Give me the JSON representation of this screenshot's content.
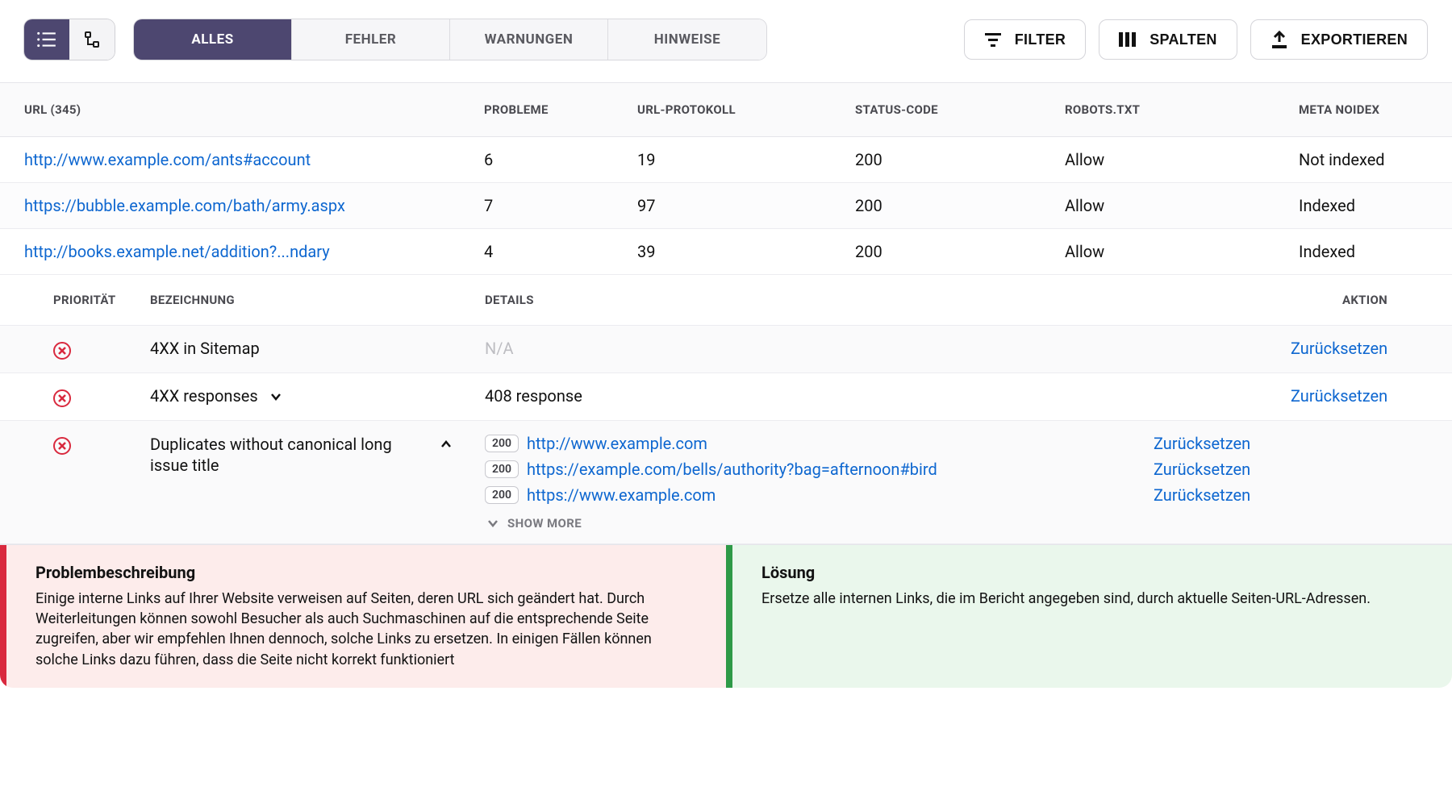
{
  "toolbar": {
    "tabs": {
      "all": "ALLES",
      "errors": "FEHLER",
      "warnings": "WARNUNGEN",
      "notes": "HINWEISE"
    },
    "filter": "FILTER",
    "columns": "SPALTEN",
    "export": "EXPORTIEREN"
  },
  "table": {
    "head": {
      "url": "URL (345)",
      "problems": "PROBLEME",
      "protocol": "URL-PROTOKOLL",
      "status": "STATUS-CODE",
      "robots": "ROBOTS.TXT",
      "noindex": "META NOIDEX"
    },
    "rows": [
      {
        "url": "http://www.example.com/ants#account",
        "problems": "6",
        "proto": "19",
        "status": "200",
        "robots": "Allow",
        "noidx": "Not indexed"
      },
      {
        "url": "https://bubble.example.com/bath/army.aspx",
        "problems": "7",
        "proto": "97",
        "status": "200",
        "robots": "Allow",
        "noidx": "Indexed"
      },
      {
        "url": "http://books.example.net/addition?...ndary",
        "problems": "4",
        "proto": "39",
        "status": "200",
        "robots": "Allow",
        "noidx": "Indexed"
      }
    ]
  },
  "subhead": {
    "priority": "PRIORITÄT",
    "label": "BEZEICHNUNG",
    "details": "DETAILS",
    "action": "AKTION"
  },
  "issues": [
    {
      "label": "4XX in Sitemap",
      "details_na": "N/A",
      "action": "Zurücksetzen"
    },
    {
      "label": "4XX responses",
      "details": "408 response",
      "action": "Zurücksetzen"
    },
    {
      "label": "Duplicates without canonical long issue title",
      "dups": [
        {
          "code": "200",
          "url": "http://www.example.com",
          "action": "Zurücksetzen"
        },
        {
          "code": "200",
          "url": "https://example.com/bells/authority?bag=afternoon#bird",
          "action": "Zurücksetzen"
        },
        {
          "code": "200",
          "url": "https://www.example.com",
          "action": "Zurücksetzen"
        }
      ],
      "showmore": "SHOW MORE"
    }
  ],
  "panels": {
    "problem": {
      "title": "Problembeschreibung",
      "body": "Einige interne Links auf Ihrer Website verweisen auf Seiten, deren URL sich geändert hat. Durch Weiterleitungen können sowohl Besucher als auch Suchmaschinen auf die entsprechende Seite zugreifen, aber wir empfehlen Ihnen dennoch, solche Links zu ersetzen. In einigen Fällen können solche Links dazu führen, dass die Seite nicht korrekt funktioniert"
    },
    "solution": {
      "title": "Lösung",
      "body": "Ersetze alle internen Links, die im Bericht angegeben sind, durch aktuelle Seiten-URL-Adressen."
    }
  }
}
